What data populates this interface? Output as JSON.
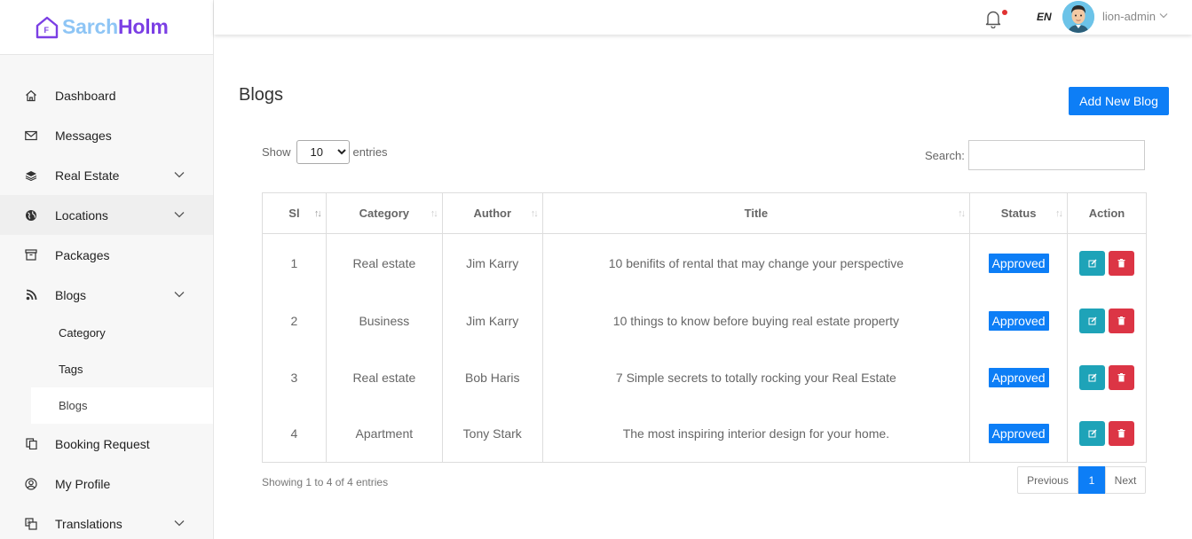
{
  "brand": {
    "part1": "Sarch",
    "part2": "Holm"
  },
  "sidebar": {
    "items": [
      {
        "label": "Dashboard",
        "icon": "home-icon"
      },
      {
        "label": "Messages",
        "icon": "envelope-icon"
      },
      {
        "label": "Real Estate",
        "icon": "layers-icon"
      },
      {
        "label": "Locations",
        "icon": "globe-icon"
      },
      {
        "label": "Packages",
        "icon": "archive-icon"
      },
      {
        "label": "Blogs",
        "icon": "rss-icon"
      },
      {
        "label": "Booking Request",
        "icon": "copy-icon"
      },
      {
        "label": "My Profile",
        "icon": "user-circle-icon"
      },
      {
        "label": "Translations",
        "icon": "translate-icon"
      }
    ],
    "blog_sub": [
      "Category",
      "Tags",
      "Blogs"
    ]
  },
  "topbar": {
    "lang": "EN",
    "username": "lion-admin"
  },
  "page": {
    "title": "Blogs",
    "add_button": "Add New Blog",
    "show_label": "Show",
    "entries_label": "entries",
    "page_size": "10",
    "search_label": "Search:",
    "info": "Showing 1 to 4 of 4 entries",
    "pager": {
      "prev": "Previous",
      "current": "1",
      "next": "Next"
    }
  },
  "table": {
    "headers": [
      "Sl",
      "Category",
      "Author",
      "Title",
      "Status",
      "Action"
    ],
    "rows": [
      {
        "sl": "1",
        "category": "Real estate",
        "author": "Jim Karry",
        "title": "10 benifits of rental that may change your perspective",
        "status": "Approved"
      },
      {
        "sl": "2",
        "category": "Business",
        "author": "Jim Karry",
        "title": "10 things to know before buying real estate property",
        "status": "Approved"
      },
      {
        "sl": "3",
        "category": "Real estate",
        "author": "Bob Haris",
        "title": "7 Simple secrets to totally rocking your Real Estate",
        "status": "Approved"
      },
      {
        "sl": "4",
        "category": "Apartment",
        "author": "Tony Stark",
        "title": "The most inspiring interior design for your home.",
        "status": "Approved"
      }
    ]
  },
  "colors": {
    "primary": "#0d7ef6",
    "edit": "#1ea3b8",
    "delete": "#dc3545",
    "brand_light": "#8ec5f5",
    "brand_dark": "#7b3fe4"
  }
}
